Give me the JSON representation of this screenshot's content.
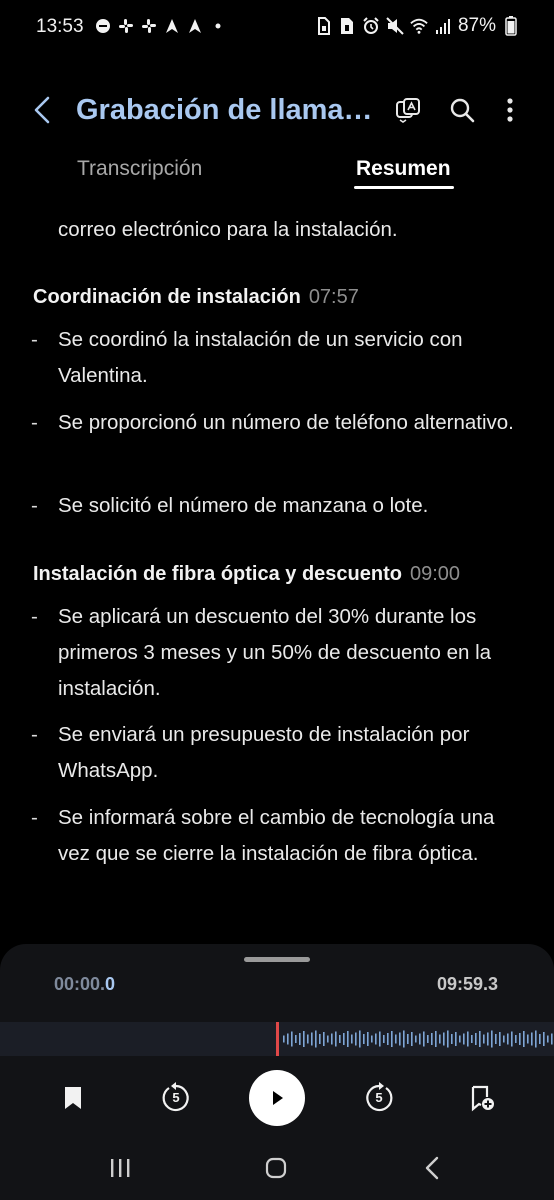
{
  "status_bar": {
    "time": "13:53",
    "battery": "87%",
    "left_icons": [
      "do-not-disturb-icon",
      "slack-icon",
      "slack-icon",
      "navigation-icon",
      "navigation-icon",
      "dot-icon"
    ],
    "right_icons": [
      "sim-icon",
      "sim-icon",
      "alarm-icon",
      "mute-icon",
      "wifi-icon",
      "signal-icon",
      "battery-icon"
    ]
  },
  "app_bar": {
    "title": "Grabación de llama…",
    "icons": [
      "back-icon",
      "ai-translate-icon",
      "search-icon",
      "more-vert-icon"
    ]
  },
  "tabs": [
    {
      "label": "Transcripción",
      "selected": false
    },
    {
      "label": "Resumen",
      "selected": true
    }
  ],
  "summary": {
    "intro": "correo electrónico para la instalación.",
    "sections": [
      {
        "title": "Coordinación de instalación",
        "time": "07:57",
        "bullets": [
          "Se coordinó la instalación de un servicio con Valentina.",
          "Se proporcionó un número de teléfono alternativo.",
          "Se solicitó el número de manzana o lote."
        ]
      },
      {
        "title": "Instalación de fibra óptica y descuento",
        "time": "09:00",
        "bullets": [
          "Se aplicará un descuento del 30% durante los primeros 3 meses y un 50% de descuento en la instalación.",
          "Se enviará un presupuesto de instalación por WhatsApp.",
          "Se informará sobre el cambio de tecnología una vez que se cierre la instalación de fibra óptica."
        ]
      }
    ]
  },
  "player": {
    "current_time_main": "00:00.",
    "current_time_frac": "0",
    "total_time": "09:59.3",
    "progress": 0,
    "skip_seconds": "5",
    "controls": [
      "bookmark-icon",
      "rewind-5-icon",
      "play-icon",
      "forward-5-icon",
      "add-bookmark-icon"
    ]
  },
  "nav_bar": {
    "buttons": [
      "recents-icon",
      "home-icon",
      "back-icon"
    ]
  },
  "colors": {
    "accent": "#a9c8f0",
    "background": "#000000",
    "panel": "#121316",
    "playhead": "#e04848"
  }
}
